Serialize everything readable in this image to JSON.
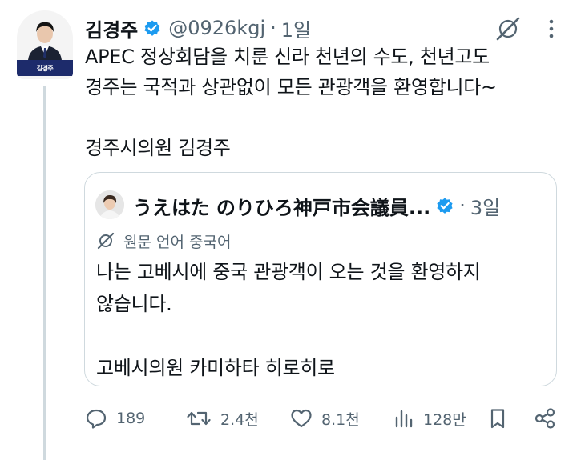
{
  "author": {
    "display_name": "김경주",
    "handle": "@0926kgj",
    "time": "1일",
    "avatar_caption": "김경주"
  },
  "post": {
    "text": "APEC 정상회담을 치룬 신라 천년의 수도, 천년고도\n경주는 국적과 상관없이 모든 관광객을 환영합니다~",
    "signature": "경주시의원 김경주"
  },
  "quote": {
    "display_name": "うえはた のりひろ神戸市会議員...",
    "time": "3일",
    "translate_label": "원문 언어 중국어",
    "text": "나는 고베시에 중국 관광객이 오는 것을 환영하지\n않습니다.",
    "signature": "고베시의원    카미하타 히로히로"
  },
  "actions": {
    "replies": "189",
    "reposts": "2.4천",
    "likes": "8.1천",
    "views": "128만"
  },
  "colors": {
    "text_primary": "#0f1419",
    "text_secondary": "#536471",
    "verified_blue": "#1d9bf0",
    "border": "#cfd9de"
  },
  "icons": [
    "verified-badge-icon",
    "grok-icon",
    "more-icon",
    "translate-icon",
    "reply-icon",
    "repost-icon",
    "like-icon",
    "views-icon",
    "bookmark-icon",
    "share-icon"
  ]
}
